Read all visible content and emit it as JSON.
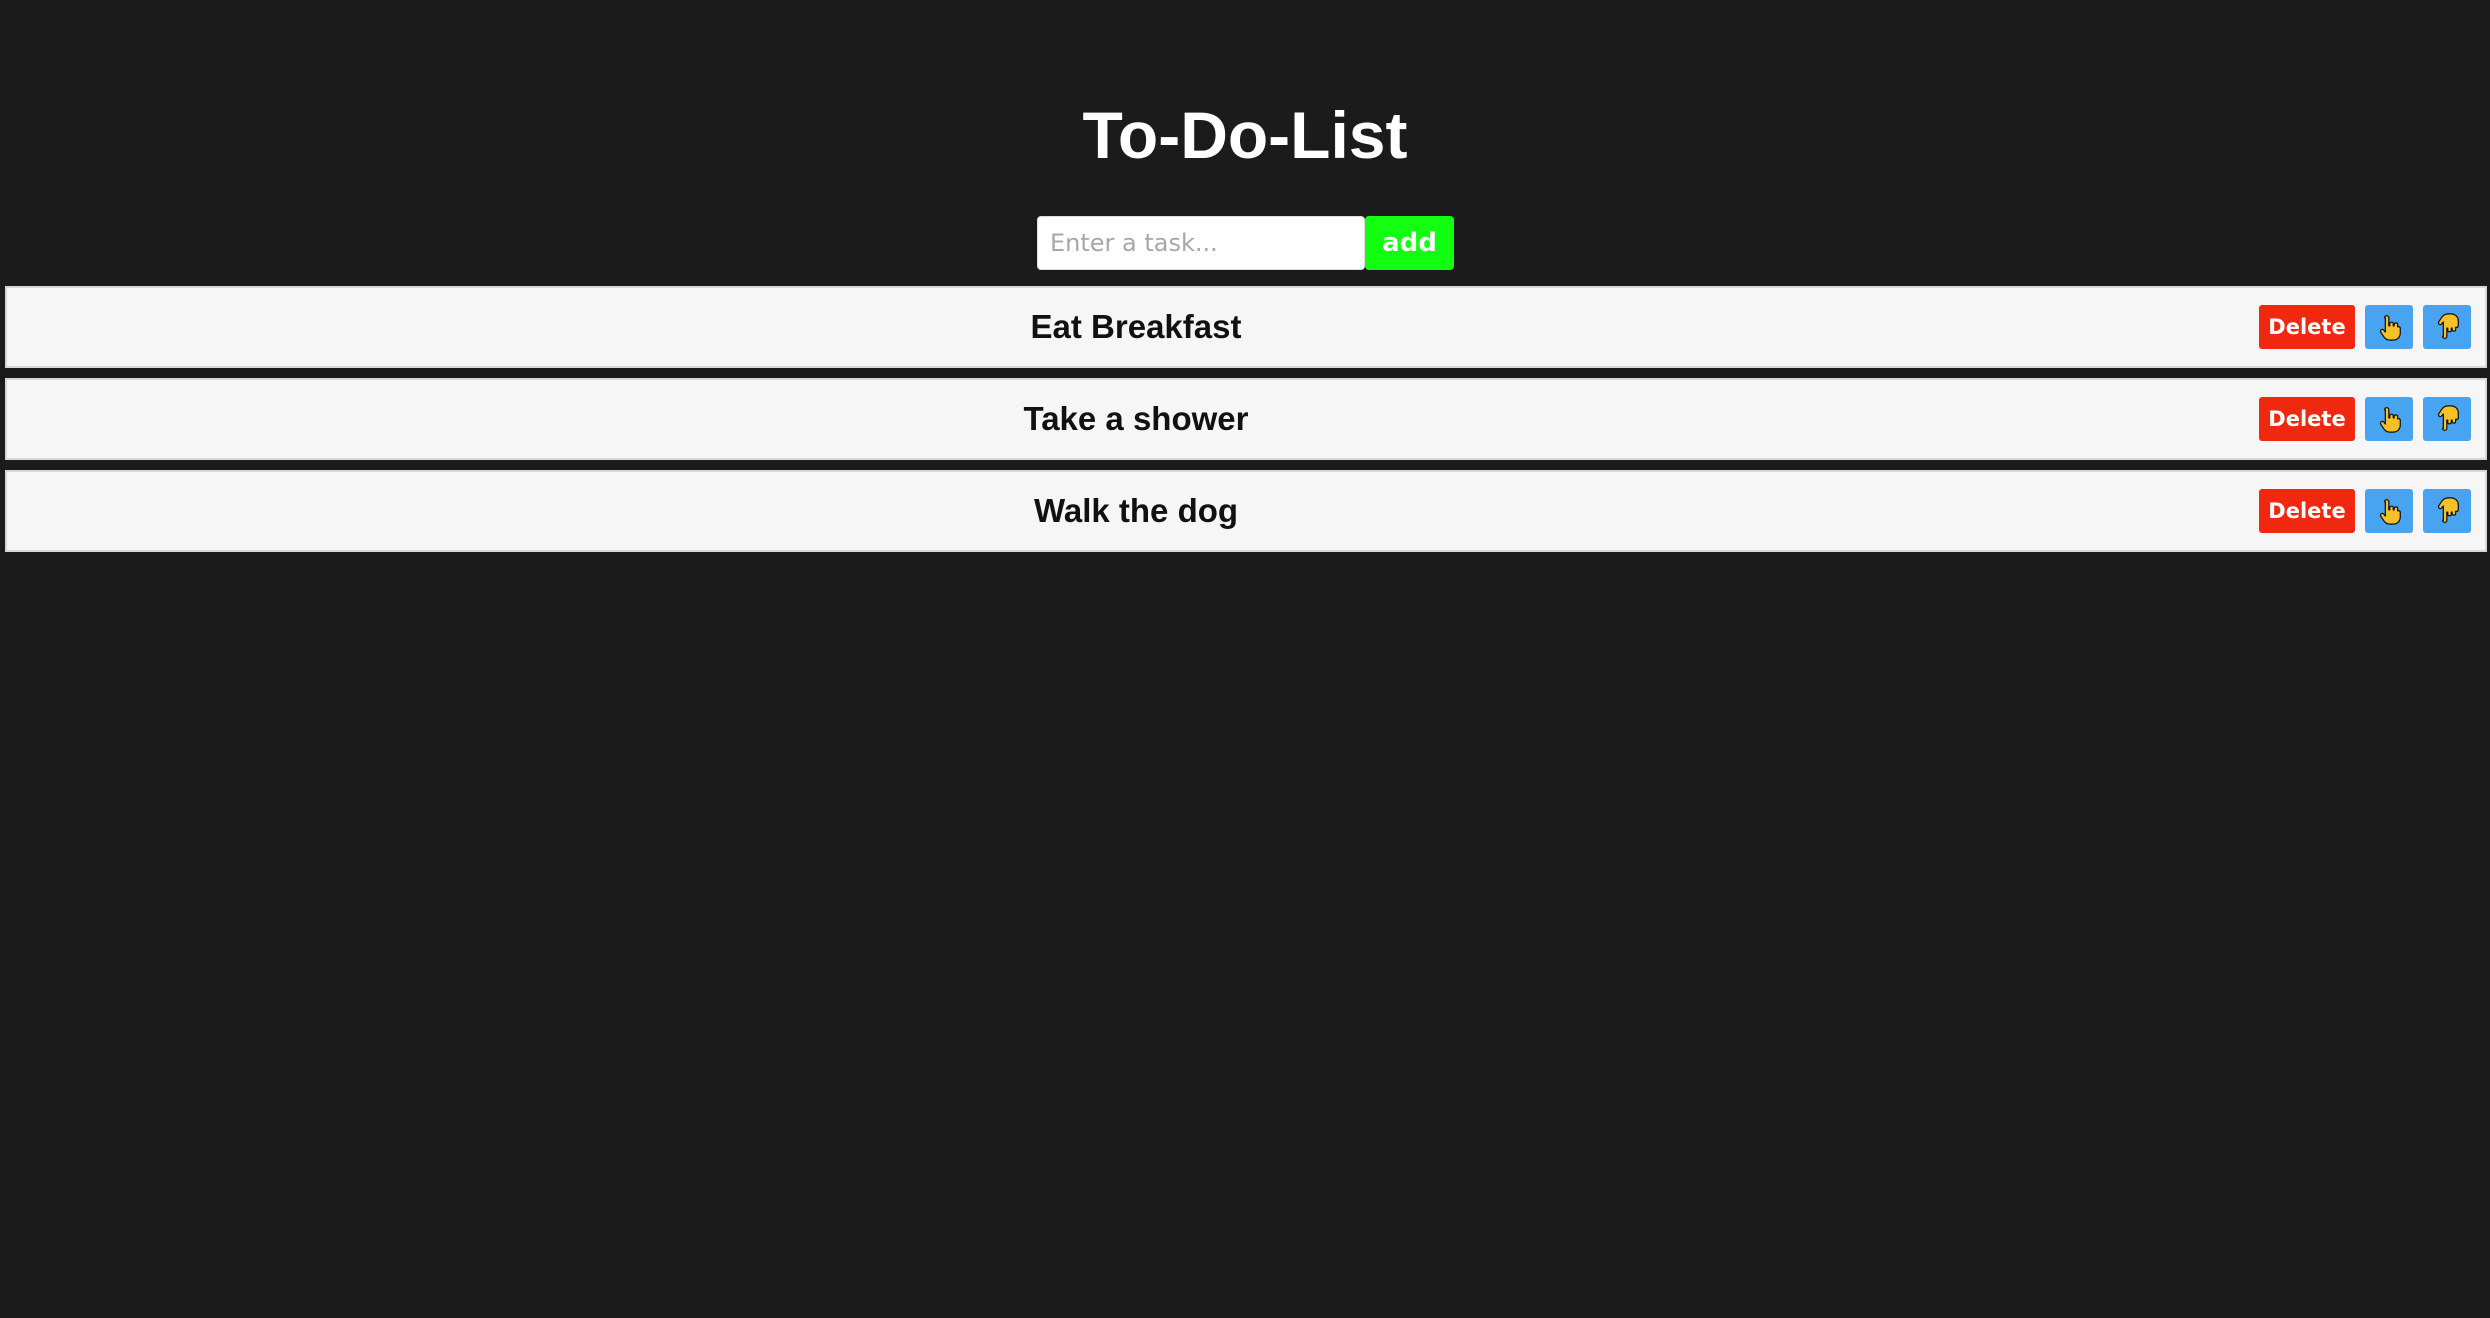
{
  "app": {
    "title": "To-Do-List"
  },
  "input": {
    "value": "",
    "placeholder": "Enter a task..."
  },
  "add_button": {
    "label": "add"
  },
  "tasks": [
    {
      "text": "Eat Breakfast",
      "delete_label": "Delete",
      "move_up_icon": "pointing-up-hand-icon",
      "move_down_icon": "pointing-down-hand-icon"
    },
    {
      "text": "Take a shower",
      "delete_label": "Delete",
      "move_up_icon": "pointing-up-hand-icon",
      "move_down_icon": "pointing-down-hand-icon"
    },
    {
      "text": "Walk the dog",
      "delete_label": "Delete",
      "move_up_icon": "pointing-up-hand-icon",
      "move_down_icon": "pointing-down-hand-icon"
    }
  ],
  "colors": {
    "background": "#1b1b1b",
    "add_button": "#12ff12",
    "delete_button": "#f0280f",
    "move_button": "#48a3f0",
    "task_row": "#f6f6f6",
    "hand_icon": "#f5c02a"
  }
}
